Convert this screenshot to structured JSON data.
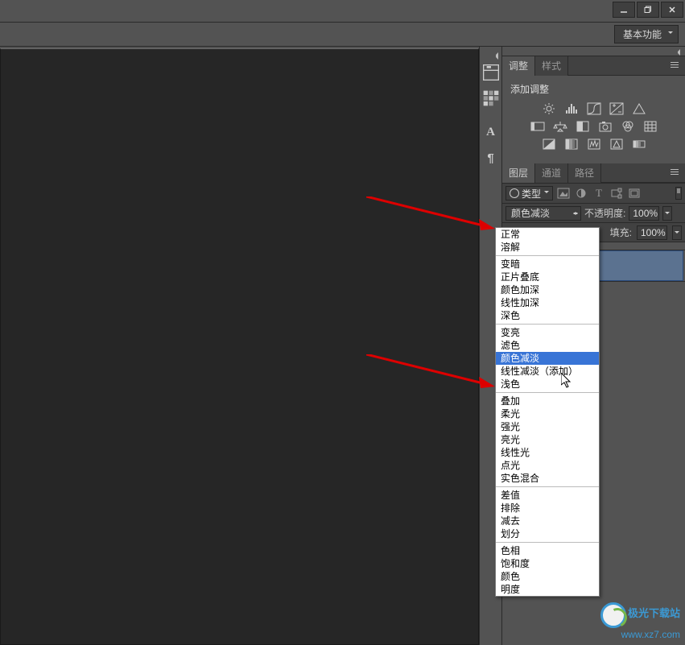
{
  "window": {
    "minimize": "—",
    "restore": "❐",
    "close": "✕"
  },
  "workspace": {
    "selected": "基本功能"
  },
  "dock": {
    "history": "H",
    "swatches": "S",
    "char": "A",
    "para": "¶"
  },
  "adjustments": {
    "tab1": "调整",
    "tab2": "样式",
    "title": "添加调整"
  },
  "layers": {
    "tab1": "图层",
    "tab2": "通道",
    "tab3": "路径",
    "filter_label": "类型",
    "blend_selected": "颜色减淡",
    "opacity_label": "不透明度:",
    "opacity_value": "100%",
    "fill_label": "填充:",
    "fill_value": "100%"
  },
  "blend_modes": {
    "g1": [
      "正常",
      "溶解"
    ],
    "g2": [
      "变暗",
      "正片叠底",
      "颜色加深",
      "线性加深",
      "深色"
    ],
    "g3": [
      "变亮",
      "滤色",
      "颜色减淡",
      "线性减淡（添加）",
      "浅色"
    ],
    "g4": [
      "叠加",
      "柔光",
      "强光",
      "亮光",
      "线性光",
      "点光",
      "实色混合"
    ],
    "g5": [
      "差值",
      "排除",
      "减去",
      "划分"
    ],
    "g6": [
      "色相",
      "饱和度",
      "颜色",
      "明度"
    ]
  },
  "highlighted_mode": "颜色减淡",
  "watermark": {
    "name": "极光下载站",
    "url": "www.xz7.com"
  }
}
